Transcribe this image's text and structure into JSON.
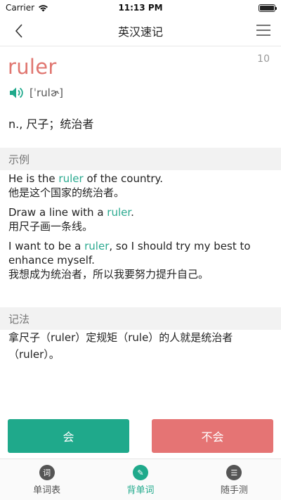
{
  "status_bar": {
    "carrier": "Carrier",
    "time": "11:13 PM"
  },
  "nav": {
    "title": "英汉速记"
  },
  "word": {
    "count": "10",
    "text": "ruler",
    "phonetic": "[ˈrulɚ]",
    "meaning": "n., 尺子；统治者"
  },
  "examples_section": {
    "title": "示例",
    "items": [
      {
        "en_before": "He is the ",
        "en_hl": "ruler",
        "en_after": " of the country.",
        "zh": "他是这个国家的统治者。"
      },
      {
        "en_before": "Draw a line with a ",
        "en_hl": "ruler",
        "en_after": ".",
        "zh": "用尺子画一条线。"
      },
      {
        "en_before": "I want to be a ",
        "en_hl": "ruler",
        "en_after": ", so I should try my best to enhance myself.",
        "zh": "我想成为统治者，所以我要努力提升自己。"
      }
    ]
  },
  "mnemonic_section": {
    "title": "记法",
    "text": "拿尺子（ruler）定规矩（rule）的人就是统治者（ruler）。"
  },
  "buttons": {
    "know": "会",
    "dont_know": "不会"
  },
  "tabs": [
    {
      "label": "单词表",
      "icon_glyph": "词"
    },
    {
      "label": "背单词",
      "icon_glyph": "✎"
    },
    {
      "label": "随手测",
      "icon_glyph": "☰"
    }
  ],
  "colors": {
    "accent": "#1fa98b",
    "danger": "#e57474",
    "word": "#e07670"
  }
}
